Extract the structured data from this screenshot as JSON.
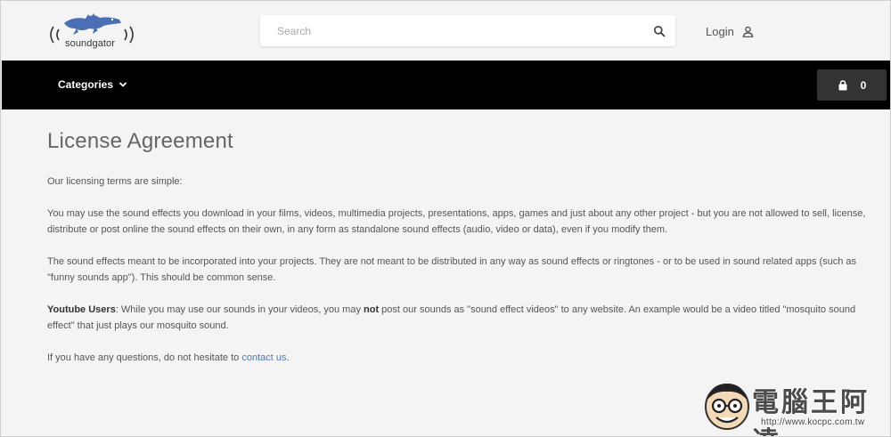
{
  "header": {
    "logo_text": "soundgator",
    "search_placeholder": "Search",
    "login_label": "Login"
  },
  "nav": {
    "categories_label": "Categories",
    "cart_count": "0"
  },
  "content": {
    "title": "License Agreement",
    "intro": "Our licensing terms are simple:",
    "para_use": "You may use the sound effects you download in your films, videos, multimedia projects, presentations, apps, games and just about any other project - but you are not allowed to sell, license, distribute or post online the sound effects on their own, in any form as standalone sound effects (audio, video or data), even if you modify them.",
    "para_meant": "The sound effects meant to be incorporated into your projects. They are not meant to be distributed in any way as sound effects or ringtones - or to be used in sound related apps (such as \"funny sounds app\"). This should be common sense.",
    "youtube_label": "Youtube Users",
    "youtube_text_a": ": While you may use our sounds in your videos, you may ",
    "youtube_not": "not",
    "youtube_text_b": " post our sounds as \"sound effect videos\" to any website. An example would be a video titled \"mosquito sound effect\" that just plays our mosquito sound.",
    "questions_text": "If you have any questions, do not hesitate to ",
    "contact_link": "contact us",
    "questions_end": "."
  },
  "watermark": {
    "title": "電腦王阿達",
    "url": "http://www.kocpc.com.tw"
  },
  "colors": {
    "navbar": "#000000",
    "cart": "#333333",
    "link": "#4a7ab8",
    "logo": "#4a6fb5"
  }
}
